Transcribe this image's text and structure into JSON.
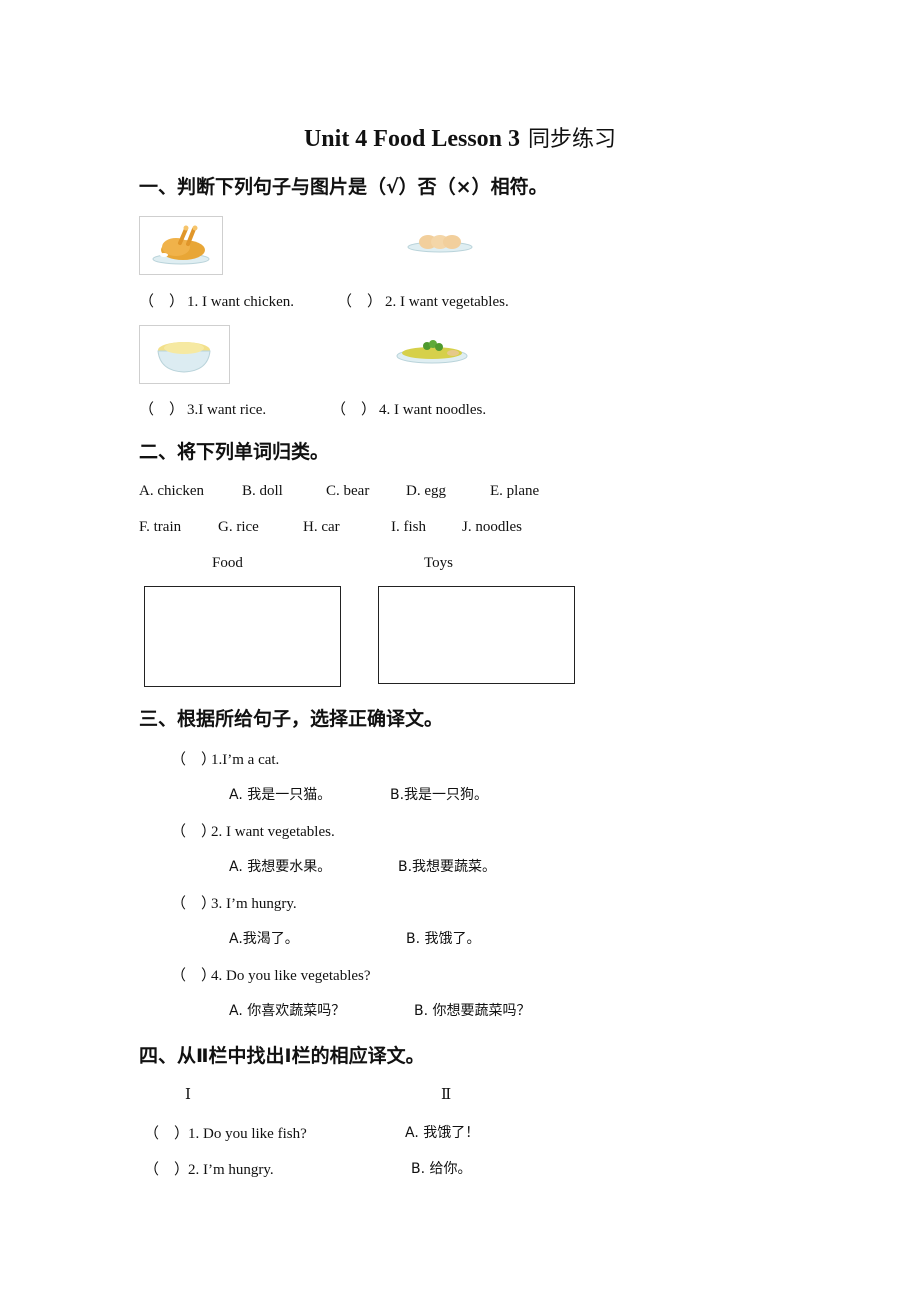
{
  "title": {
    "english": "Unit 4 Food Lesson 3",
    "chinese": "同步练习"
  },
  "section1": {
    "heading": "一、判断下列句子与图片是（√）否（×）相符。",
    "items": [
      {
        "paren": "（　）",
        "text": "1. I want chicken.",
        "image": "roast-chicken-icon"
      },
      {
        "paren": "（　）",
        "text": "2. I want vegetables.",
        "image": "eggs-on-plate-icon"
      },
      {
        "paren": "（　）",
        "text": "3.I want rice.",
        "image": "rice-bowl-icon"
      },
      {
        "paren": "（　）",
        "text": "4. I want noodles.",
        "image": "noodles-plate-icon"
      }
    ]
  },
  "section2": {
    "heading": "二、将下列单词归类。",
    "row1": [
      "A. chicken",
      "B. doll",
      "C. bear",
      "D. egg",
      "E. plane"
    ],
    "row2": [
      "F. train",
      "G. rice",
      "H. car",
      "I. fish",
      "J. noodles"
    ],
    "categories": [
      "Food",
      "Toys"
    ]
  },
  "section3": {
    "heading": "三、根据所给句子，选择正确译文。",
    "questions": [
      {
        "paren": "（　）",
        "text": "1.I’m a cat.",
        "a": "A.  我是一只猫。",
        "b": "B.我是一只狗。"
      },
      {
        "paren": "（　）",
        "text": "2. I want vegetables.",
        "a": "A.  我想要水果。",
        "b": "B.我想要蔬菜。"
      },
      {
        "paren": "（　）",
        "text": "3. I’m hungry.",
        "a": "A.我渴了。",
        "b": "B.  我饿了。"
      },
      {
        "paren": "（　）",
        "text": "4. Do you like vegetables?",
        "a": "A.  你喜欢蔬菜吗？",
        "b": "B.  你想要蔬菜吗？"
      }
    ]
  },
  "section4": {
    "heading": "四、从Ⅱ栏中找出Ⅰ栏的相应译文。",
    "col1_label": "Ⅰ",
    "col2_label": "Ⅱ",
    "rows": [
      {
        "paren": "（　）",
        "text": "1. Do you like fish?",
        "answer": "A.  我饿了！"
      },
      {
        "paren": "（　）",
        "text": "2. I’m hungry.",
        "answer": "B.  给你。"
      }
    ]
  }
}
